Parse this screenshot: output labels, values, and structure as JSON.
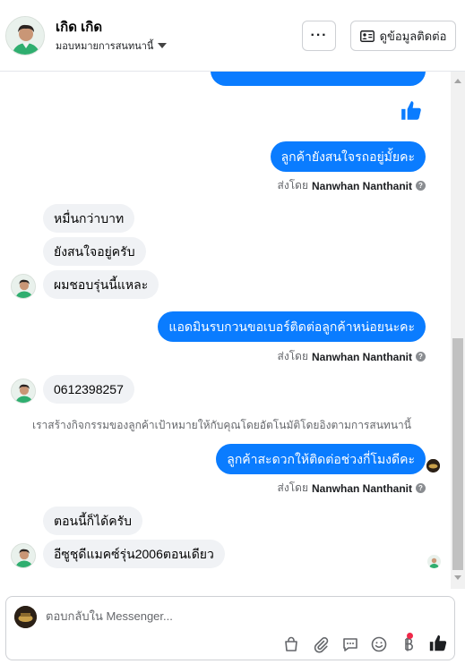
{
  "header": {
    "name": "เกิด เกิด",
    "assign_label": "มอบหมายการสนทนานี้",
    "more_label": "···",
    "contact_label": "ดูข้อมูลติดต่อ"
  },
  "conversation": {
    "messages_out": [
      {
        "text": "ลูกค้ายังสนใจรถอยู่มั้ยคะ"
      },
      {
        "text": "แอดมินรบกวนขอเบอร์ติดต่อลูกค้าหน่อยนะคะ"
      },
      {
        "text": "ลูกค้าสะดวกให้ติดต่อช่วงกี่โมงดีคะ"
      }
    ],
    "sent_by_prefix": "ส่งโดย",
    "sent_by_name": "Nanwhan Nanthanit",
    "messages_in": [
      {
        "text": "หมื่นกว่าบาท"
      },
      {
        "text": "ยังสนใจอยู่ครับ"
      },
      {
        "text": "ผมชอบรุ่นนี้แหละ"
      },
      {
        "text": "0612398257"
      },
      {
        "text": "ตอนนี้ก็ได้ครับ"
      },
      {
        "text": "อีซูชุดีแมคซ์รุ่น2006ตอนเดียว"
      }
    ],
    "system_note": "เราสร้างกิจกรรมของลูกค้าเป้าหมายให้กับคุณโดยอัตโนมัติโดยอิงตามการสนทนานี้"
  },
  "composer": {
    "placeholder": "ตอบกลับใน Messenger...",
    "tools": [
      "bag-icon",
      "paperclip-icon",
      "saved-reply-icon",
      "emoji-icon",
      "baht-icon",
      "thumbs-up-icon"
    ]
  },
  "colors": {
    "outgoing_bubble": "#0a7cff",
    "incoming_bubble": "#f0f2f5",
    "notification_dot": "#f02849"
  }
}
